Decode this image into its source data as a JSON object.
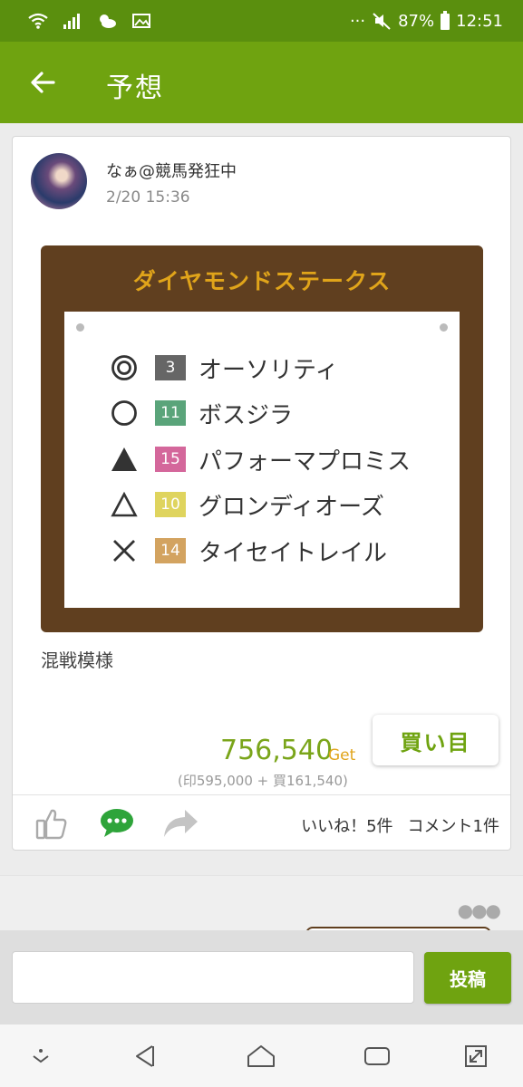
{
  "status_bar": {
    "battery": "87%",
    "time": "12:51",
    "dots": "···",
    "icons": [
      "wifi-icon",
      "signal-icon",
      "weather-icon",
      "image-icon",
      "mute-icon",
      "battery-icon"
    ]
  },
  "app_bar": {
    "title": "予想",
    "back_icon": "arrow-left-icon"
  },
  "post": {
    "author": "なぁ@競馬発狂中",
    "time": "2/20 15:36",
    "race_name": "ダイヤモンドステークス",
    "picks": [
      {
        "mark": "double-circle",
        "number": "3",
        "number_color": "#666666",
        "name": "オーソリティ"
      },
      {
        "mark": "circle",
        "number": "11",
        "number_color": "#5aa47a",
        "name": "ボスジラ"
      },
      {
        "mark": "filled-triangle",
        "number": "15",
        "number_color": "#d4679b",
        "name": "パフォーマプロミス"
      },
      {
        "mark": "triangle",
        "number": "10",
        "number_color": "#dfd45e",
        "name": "グロンディオーズ"
      },
      {
        "mark": "cross",
        "number": "14",
        "number_color": "#d3a360",
        "name": "タイセイトレイル"
      }
    ],
    "comment": "混戦模様",
    "get_value": "756,540",
    "get_unit": "Get",
    "get_breakdown": "(印595,000 + 買161,540)",
    "kaime_label": "買い目",
    "likes_text": "いいね！5件",
    "comments_text": "コメント1件"
  },
  "comment_input": {
    "value": "",
    "placeholder": "",
    "submit_label": "投稿"
  },
  "colors": {
    "status_green": "#5a8f0e",
    "app_green": "#6fa310",
    "board_brown": "#603f1f",
    "title_gold": "#e0a41a",
    "get_green": "#7aa51a"
  }
}
